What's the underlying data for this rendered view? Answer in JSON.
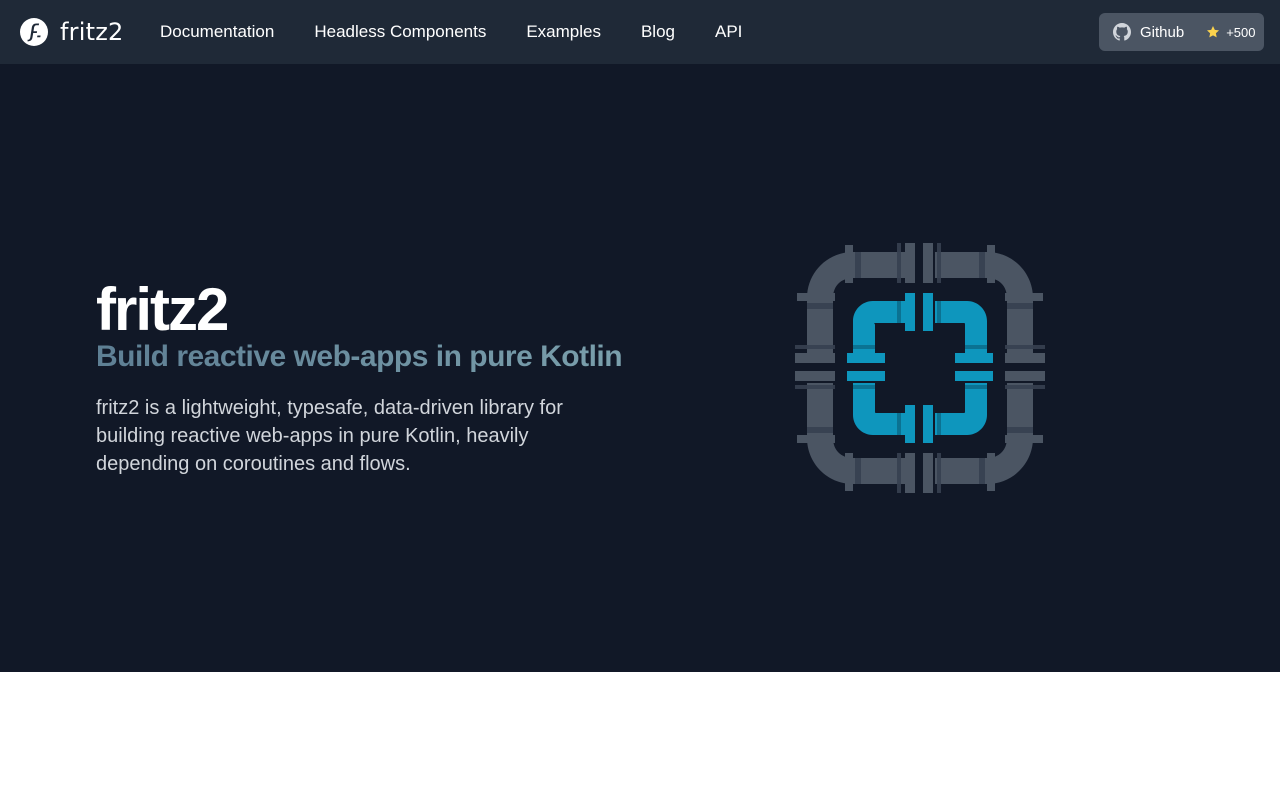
{
  "brand": {
    "name": "fritz2"
  },
  "nav": {
    "links": [
      {
        "label": "Documentation"
      },
      {
        "label": "Headless Components"
      },
      {
        "label": "Examples"
      },
      {
        "label": "Blog"
      },
      {
        "label": "API"
      }
    ],
    "github": {
      "label": "Github",
      "stars": "+500"
    }
  },
  "hero": {
    "title": "fritz2",
    "subtitle": "Build reactive web-apps in pure Kotlin",
    "description": "fritz2 is a lightweight, typesafe, data-driven library for building reactive web-apps in pure Kotlin, heavily depending on coroutines and flows."
  },
  "colors": {
    "navbar_bg": "#1f2937",
    "hero_bg": "#111827",
    "github_btn_bg": "#4b5563",
    "accent_cyan": "#0e96bd",
    "pipe_gray": "#4b5563",
    "star_yellow": "#fcd34d"
  },
  "icons": {
    "brand": "fritz2-logo-icon",
    "github": "github-icon",
    "star": "star-icon",
    "hero": "pipes-illustration"
  }
}
